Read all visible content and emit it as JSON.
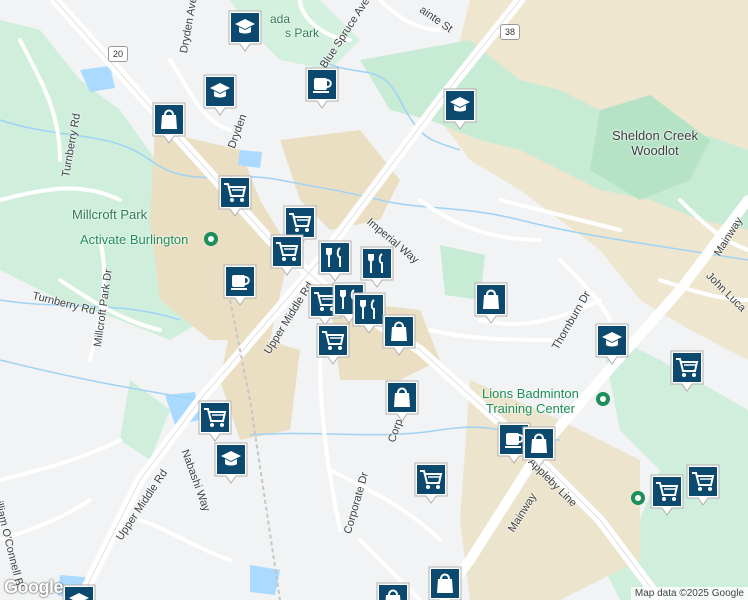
{
  "map": {
    "labels": {
      "dryden_ave_top": "Dryden Ave",
      "dryden_ave": "Dryden",
      "blue_spruce_ave": "Blue Spruce Ave",
      "ainte_st": "ainte St",
      "ada_park": "ada",
      "ada_park2": "s Park",
      "turnberry_rd": "Turnberry Rd",
      "turnberry_rd2": "Turnberry Rd",
      "millcroft_park_dr": "Millcroft Park Dr",
      "upper_middle_rd": "Upper Middle Rd",
      "upper_middle_rd2": "Upper Middle Rd",
      "imperial_way": "Imperial Way",
      "thornburn_dr": "Thornburn Dr",
      "mainway": "Mainway",
      "mainway2": "Mainway",
      "john_luca": "John Luca",
      "corporate_dr": "Corporate Dr",
      "corp": "Corp",
      "appleby_line": "Appleby Line",
      "nabashi_way": "Nabashi Way",
      "william_oconnell": "illiam O'Connell Bl",
      "sheldon_creek": "Sheldon Creek\nWoodlot",
      "lions_badminton": "Lions Badminton\nTraining Center",
      "millcroft_park": "Millcroft Park",
      "activate_burlington": "Activate Burlington"
    },
    "shields": {
      "route_20": "20",
      "route_38": "38"
    },
    "attribution": "Map data ©2025 Google",
    "logo": "Google",
    "markers": [
      {
        "icon": "school-icon",
        "name": "marker-school"
      },
      {
        "icon": "school-icon",
        "name": "marker-school"
      },
      {
        "icon": "coffee-icon",
        "name": "marker-cafe"
      },
      {
        "icon": "shopping-bag-icon",
        "name": "marker-store"
      },
      {
        "icon": "school-icon",
        "name": "marker-school"
      },
      {
        "icon": "shopping-cart-icon",
        "name": "marker-grocery"
      },
      {
        "icon": "shopping-cart-icon",
        "name": "marker-grocery"
      },
      {
        "icon": "shopping-cart-icon",
        "name": "marker-grocery"
      },
      {
        "icon": "coffee-icon",
        "name": "marker-cafe"
      },
      {
        "icon": "restaurant-icon",
        "name": "marker-restaurant"
      },
      {
        "icon": "restaurant-icon",
        "name": "marker-restaurant"
      },
      {
        "icon": "shopping-cart-icon",
        "name": "marker-grocery"
      },
      {
        "icon": "restaurant-icon",
        "name": "marker-restaurant"
      },
      {
        "icon": "restaurant-icon",
        "name": "marker-restaurant"
      },
      {
        "icon": "shopping-bag-icon",
        "name": "marker-store"
      },
      {
        "icon": "shopping-cart-icon",
        "name": "marker-grocery"
      },
      {
        "icon": "shopping-bag-icon",
        "name": "marker-store"
      },
      {
        "icon": "shopping-bag-icon",
        "name": "marker-store"
      },
      {
        "icon": "school-icon",
        "name": "marker-school"
      },
      {
        "icon": "shopping-cart-icon",
        "name": "marker-grocery"
      },
      {
        "icon": "shopping-cart-icon",
        "name": "marker-grocery"
      },
      {
        "icon": "school-icon",
        "name": "marker-school"
      },
      {
        "icon": "coffee-icon",
        "name": "marker-cafe"
      },
      {
        "icon": "shopping-bag-icon",
        "name": "marker-store"
      },
      {
        "icon": "shopping-cart-icon",
        "name": "marker-grocery"
      },
      {
        "icon": "shopping-cart-icon",
        "name": "marker-grocery"
      },
      {
        "icon": "shopping-cart-icon",
        "name": "marker-grocery"
      },
      {
        "icon": "shopping-bag-icon",
        "name": "marker-store"
      },
      {
        "icon": "shopping-bag-icon",
        "name": "marker-store"
      },
      {
        "icon": "school-icon",
        "name": "marker-school"
      }
    ],
    "colors": {
      "marker_fill": "#0b4a6e",
      "park_green": "#c8ebd5",
      "commercial_tan": "#eadfc3",
      "water": "#aadaff",
      "poi_green": "#1e8e5a"
    }
  }
}
